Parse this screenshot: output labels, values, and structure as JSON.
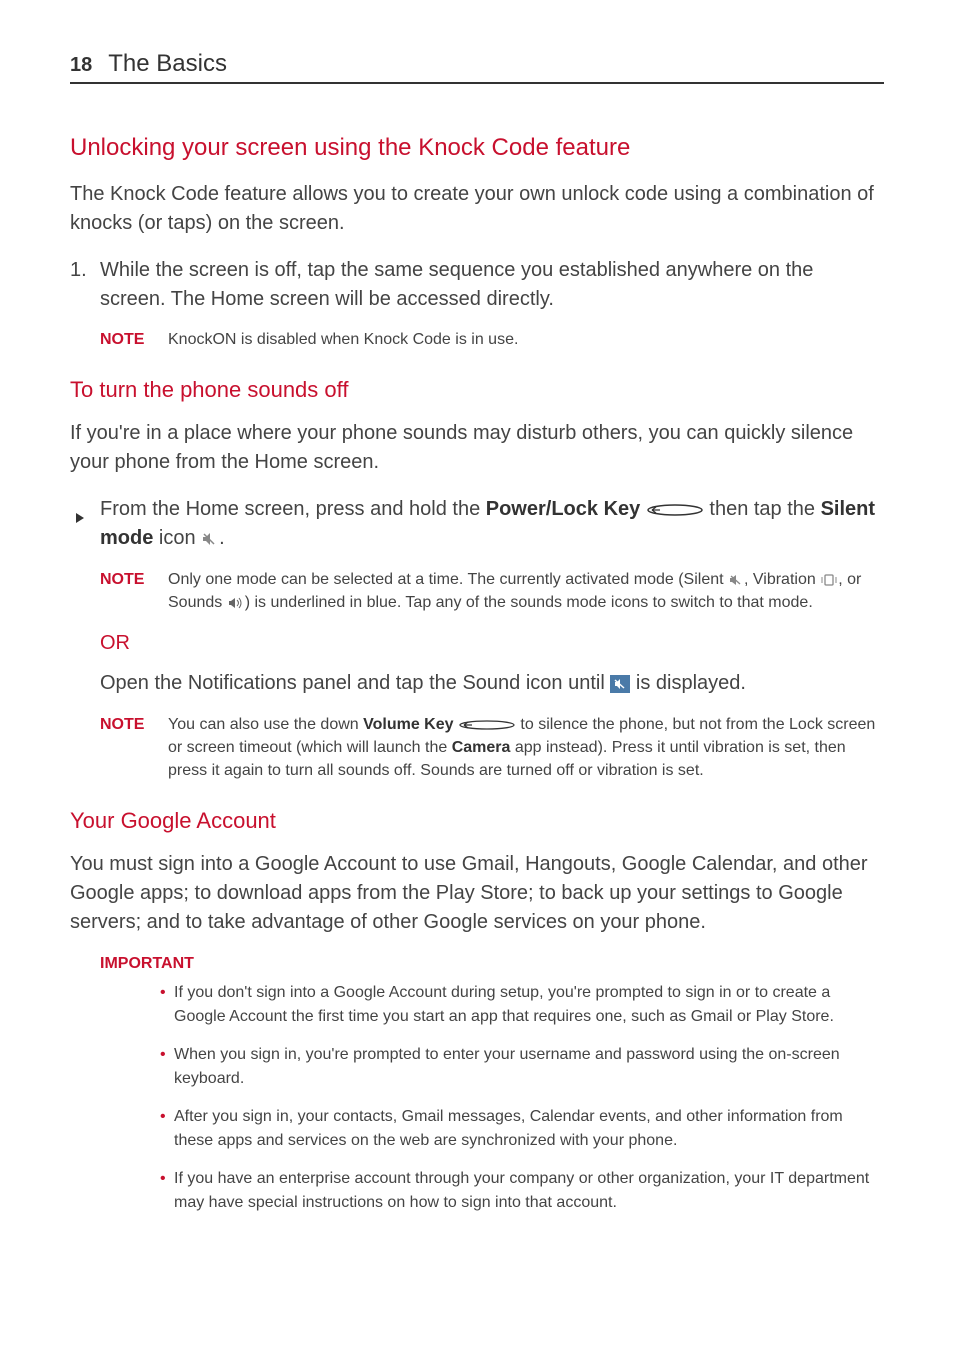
{
  "header": {
    "page_number": "18",
    "chapter_title": "The Basics"
  },
  "s1": {
    "heading": "Unlocking your screen using the Knock Code feature",
    "intro": "The Knock Code feature allows you to create your own unlock code using a combination of knocks (or taps) on the screen.",
    "step1_num": "1.",
    "step1": "While the screen is off, tap the same sequence you established anywhere on the screen. The Home screen will be accessed directly.",
    "note_label": "NOTE",
    "note": "KnockON is disabled when Knock Code is in use."
  },
  "s2": {
    "heading": "To turn the phone sounds off",
    "intro": "If you're in a place where your phone sounds may disturb others, you can quickly silence your phone from the Home screen.",
    "step_a": "From the Home screen, press and hold the ",
    "power_key": "Power/Lock Key",
    "step_b": " then tap the ",
    "silent_mode": "Silent mode",
    "step_c": " icon ",
    "step_d": ".",
    "note1_label": "NOTE",
    "note1_a": "Only one mode can be selected at a time. The currently activated mode (Silent ",
    "note1_b": ", Vibration ",
    "note1_c": ", or Sounds ",
    "note1_d": ") is underlined in blue. Tap any of the sounds mode icons to switch to that mode.",
    "or": "OR",
    "alt_a": "Open the Notifications panel and tap the Sound icon until ",
    "alt_b": " is displayed.",
    "note2_label": "NOTE",
    "note2_a": "You can also use the down ",
    "volume_key": "Volume Key",
    "note2_b": " to silence the phone, but not from the Lock screen or screen timeout (which will launch the ",
    "camera": "Camera",
    "note2_c": " app instead). Press it until vibration is set, then press it again to turn all sounds off. Sounds are turned off or vibration is set."
  },
  "s3": {
    "heading": "Your Google Account",
    "intro": "You must sign into a Google Account to use Gmail, Hangouts, Google Calendar, and other Google apps; to download apps from the Play Store; to back up your settings to Google servers; and to take advantage of other Google services on your phone.",
    "important": "IMPORTANT",
    "b1": "If you don't sign into a Google Account during setup, you're prompted to sign in or to create a Google Account the first time you start an app that requires one, such as Gmail or Play Store.",
    "b2": "When you sign in, you're prompted to enter your username and password using the on-screen keyboard.",
    "b3": "After you sign in, your contacts, Gmail messages, Calendar events, and other information from these apps and services on the web are synchronized with your phone.",
    "b4": "If you have an enterprise account through your company or other organization, your IT department may have special instructions on how to sign into that account."
  }
}
